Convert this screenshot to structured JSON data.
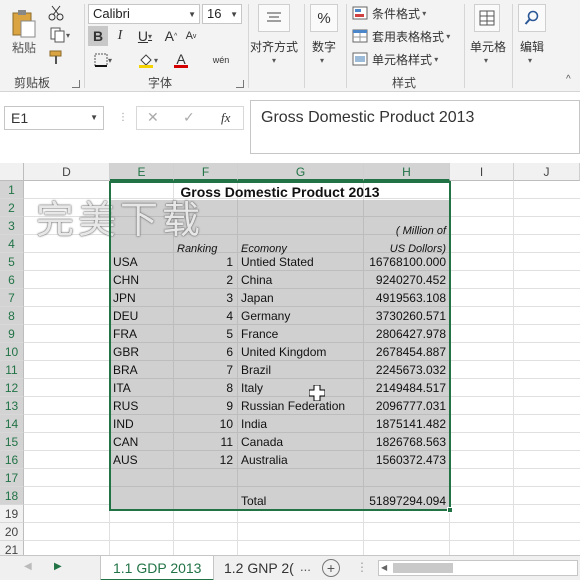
{
  "ribbon": {
    "clipboard": {
      "paste_label": "粘贴",
      "group_label": "剪贴板"
    },
    "font": {
      "font_name": "Calibri",
      "font_size": "16",
      "bold": "B",
      "italic": "I",
      "underline": "U",
      "grow": "A",
      "shrink": "A",
      "font_color_letter": "A",
      "phonetic": "wén",
      "group_label": "字体"
    },
    "alignment": {
      "label": "对齐方式"
    },
    "number": {
      "label": "数字",
      "icon_text": "%"
    },
    "styles": {
      "conditional": "条件格式",
      "table": "套用表格格式",
      "cell_styles": "单元格样式",
      "group_label": "样式"
    },
    "cells": {
      "label": "单元格"
    },
    "editing": {
      "label": "编辑"
    }
  },
  "formula_bar": {
    "name_box": "E1",
    "fx": "fx",
    "cancel": "✕",
    "enter": "✓",
    "formula": "Gross Domestic Product 2013"
  },
  "grid": {
    "columns": [
      "D",
      "E",
      "F",
      "G",
      "H",
      "I",
      "J"
    ],
    "rows": [
      "1",
      "2",
      "3",
      "4",
      "5",
      "6",
      "7",
      "8",
      "9",
      "10",
      "11",
      "12",
      "13",
      "14",
      "15",
      "16",
      "17",
      "18",
      "19",
      "20",
      "21"
    ],
    "title": "Gross Domestic Product 2013",
    "header_h3": "( Million of",
    "header_f4": "Ranking",
    "header_g4": "Ecomony",
    "header_h4": "US Dollors)",
    "data": [
      {
        "code": "USA",
        "rank": "1",
        "economy": "Untied Stated",
        "gdp": "16768100.000"
      },
      {
        "code": "CHN",
        "rank": "2",
        "economy": "China",
        "gdp": "9240270.452"
      },
      {
        "code": "JPN",
        "rank": "3",
        "economy": "Japan",
        "gdp": "4919563.108"
      },
      {
        "code": "DEU",
        "rank": "4",
        "economy": "Germany",
        "gdp": "3730260.571"
      },
      {
        "code": "FRA",
        "rank": "5",
        "economy": "France",
        "gdp": "2806427.978"
      },
      {
        "code": "GBR",
        "rank": "6",
        "economy": "United Kingdom",
        "gdp": "2678454.887"
      },
      {
        "code": "BRA",
        "rank": "7",
        "economy": "Brazil",
        "gdp": "2245673.032"
      },
      {
        "code": "ITA",
        "rank": "8",
        "economy": "Italy",
        "gdp": "2149484.517"
      },
      {
        "code": "RUS",
        "rank": "9",
        "economy": "Russian Federation",
        "gdp": "2096777.031"
      },
      {
        "code": "IND",
        "rank": "10",
        "economy": "India",
        "gdp": "1875141.482"
      },
      {
        "code": "CAN",
        "rank": "11",
        "economy": "Canada",
        "gdp": "1826768.563"
      },
      {
        "code": "AUS",
        "rank": "12",
        "economy": "Australia",
        "gdp": "1560372.473"
      }
    ],
    "total_label": "Total",
    "total_value": "51897294.094",
    "watermark": "完美下载"
  },
  "tabs": {
    "sheet1": "1.1 GDP 2013",
    "sheet2": "1.2 GNP 2(",
    "more": "...",
    "add": "+"
  },
  "colors": {
    "accent": "#217346",
    "selection_fill": "#d0d0d0"
  }
}
